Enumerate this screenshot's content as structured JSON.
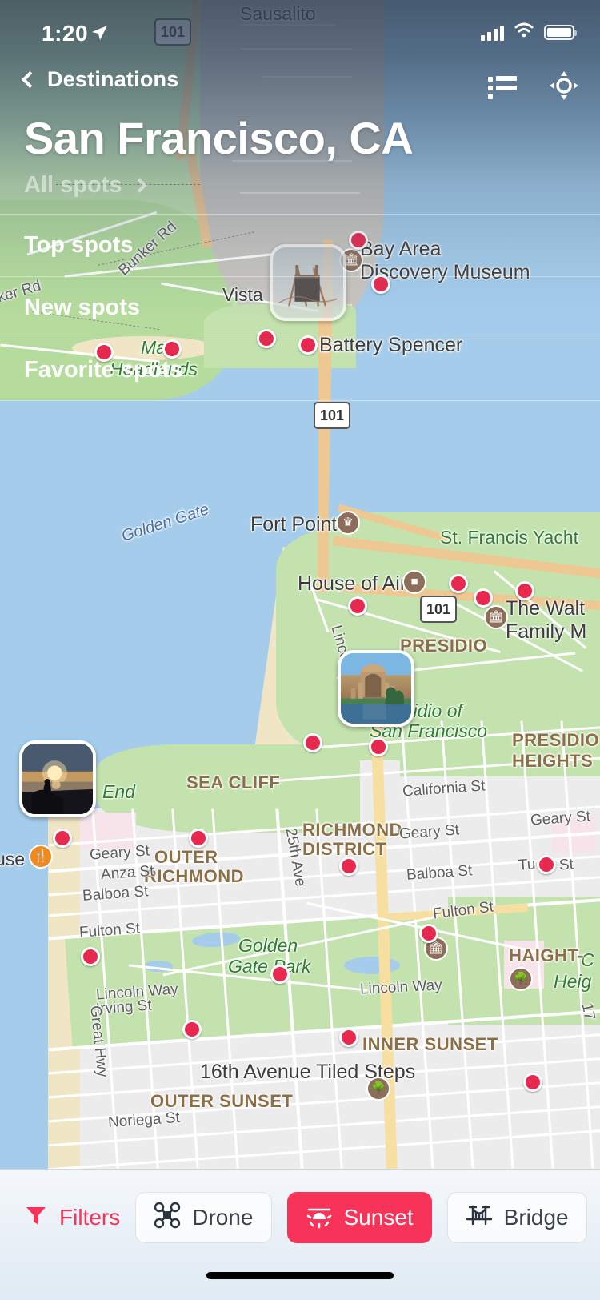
{
  "status_bar": {
    "time": "1:20",
    "location_arrow_icon": "location-arrow-icon",
    "cellular_icon": "cellular-signal-icon",
    "wifi_icon": "wifi-icon",
    "battery_icon": "battery-icon"
  },
  "nav": {
    "back_label": "Destinations",
    "back_icon": "chevron-left-icon",
    "list_icon": "list-view-icon",
    "locate_icon": "locate-me-icon"
  },
  "header": {
    "title": "San Francisco, CA",
    "all_spots_label": "All spots",
    "all_spots_chevron": "chevron-right-icon"
  },
  "menu": {
    "items": [
      {
        "label": "Top spots"
      },
      {
        "label": "New spots"
      },
      {
        "label": "Favorite spots"
      }
    ]
  },
  "filter_bar": {
    "filters_label": "Filters",
    "filters_icon": "funnel-icon",
    "chips": [
      {
        "label": "Drone",
        "icon": "drone-icon",
        "active": false
      },
      {
        "label": "Sunset",
        "icon": "sunset-icon",
        "active": true
      },
      {
        "label": "Bridge",
        "icon": "bridge-icon",
        "active": false
      }
    ]
  },
  "colors": {
    "accent": "#f8335a",
    "pin": "#e8294f",
    "header_text": "#ffffff",
    "map_water": "#a5cdeb",
    "map_park": "#c3e2ae",
    "map_land": "#ececec"
  },
  "map": {
    "places": [
      {
        "name": "Sausalito"
      },
      {
        "name": "Bay Area"
      },
      {
        "name": "Discovery Museum"
      },
      {
        "name": "Vista"
      },
      {
        "name": "Battery Spencer"
      },
      {
        "name": "Fort Point"
      },
      {
        "name": "House of Air"
      },
      {
        "name": "St. Francis Yacht"
      },
      {
        "name": "The Walt"
      },
      {
        "name": "Family M"
      },
      {
        "name": "16th Avenue Tiled Steps"
      }
    ],
    "parks": [
      {
        "name": "Ma"
      },
      {
        "name": "Headlands"
      },
      {
        "name": "Golden Gate"
      },
      {
        "name": "End"
      },
      {
        "name": "sidio of"
      },
      {
        "name": "San Francisco"
      },
      {
        "name": "Golden"
      },
      {
        "name": "Gate Park"
      },
      {
        "name": "C"
      },
      {
        "name": "Heig"
      }
    ],
    "neighborhoods": [
      {
        "name": "PRESIDIO"
      },
      {
        "name": "PRESIDIO"
      },
      {
        "name": "HEIGHTS"
      },
      {
        "name": "SEA CLIFF"
      },
      {
        "name": "RICHMOND"
      },
      {
        "name": "DISTRICT"
      },
      {
        "name": "OUTER"
      },
      {
        "name": "RICHMOND"
      },
      {
        "name": "INNER SUNSET"
      },
      {
        "name": "OUTER SUNSET"
      },
      {
        "name": "HAIGHT-"
      }
    ],
    "streets": [
      {
        "name": "Bunker Rd"
      },
      {
        "name": "ker Rd"
      },
      {
        "name": "Lincoln Blvd"
      },
      {
        "name": "California St"
      },
      {
        "name": "Geary St"
      },
      {
        "name": "Geary St"
      },
      {
        "name": "Geary St"
      },
      {
        "name": "Anza St"
      },
      {
        "name": "Balboa St"
      },
      {
        "name": "Balboa St"
      },
      {
        "name": "Fulton St"
      },
      {
        "name": "Fulton St"
      },
      {
        "name": "Lincoln Way"
      },
      {
        "name": "Lincoln Way"
      },
      {
        "name": "Irving St"
      },
      {
        "name": "Noriega St"
      },
      {
        "name": "25th Ave"
      },
      {
        "name": "Great Hwy"
      },
      {
        "name": "Tu"
      },
      {
        "name": "St"
      },
      {
        "name": "use"
      },
      {
        "name": "17"
      }
    ],
    "highway_shields": [
      {
        "number": "101"
      },
      {
        "number": "101"
      },
      {
        "number": "101"
      }
    ],
    "callouts": [
      {
        "name": "golden-gate-bridge-photo"
      },
      {
        "name": "palace-of-fine-arts-photo"
      },
      {
        "name": "lands-end-sunset-photo"
      }
    ]
  }
}
